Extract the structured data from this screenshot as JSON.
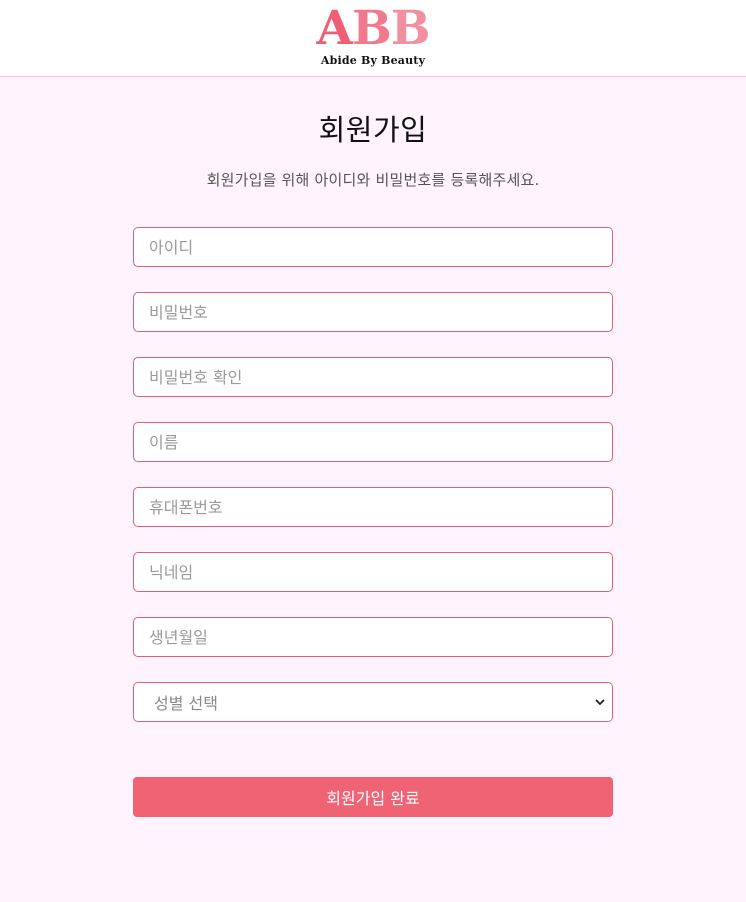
{
  "header": {
    "logo_letters": [
      "A",
      "B",
      "B"
    ],
    "logo_tagline": "Abide By Beauty"
  },
  "page": {
    "title": "회원가입",
    "subtitle": "회원가입을 위해 아이디와 비밀번호를 등록해주세요."
  },
  "form": {
    "fields": {
      "user_id": {
        "placeholder": "아이디",
        "value": ""
      },
      "password": {
        "placeholder": "비밀번호",
        "value": ""
      },
      "password_confirm": {
        "placeholder": "비밀번호 확인",
        "value": ""
      },
      "name": {
        "placeholder": "이름",
        "value": ""
      },
      "phone": {
        "placeholder": "휴대폰번호",
        "value": ""
      },
      "nickname": {
        "placeholder": "닉네임",
        "value": ""
      },
      "birthdate": {
        "placeholder": "생년월일",
        "value": ""
      }
    },
    "gender_select": {
      "selected": "성별 선택"
    },
    "submit_label": "회원가입 완료"
  },
  "colors": {
    "accent": "#f06375",
    "border": "#e0607a",
    "background": "#fff4fd"
  },
  "icons": {
    "select_arrow": "chevron-down-icon"
  }
}
